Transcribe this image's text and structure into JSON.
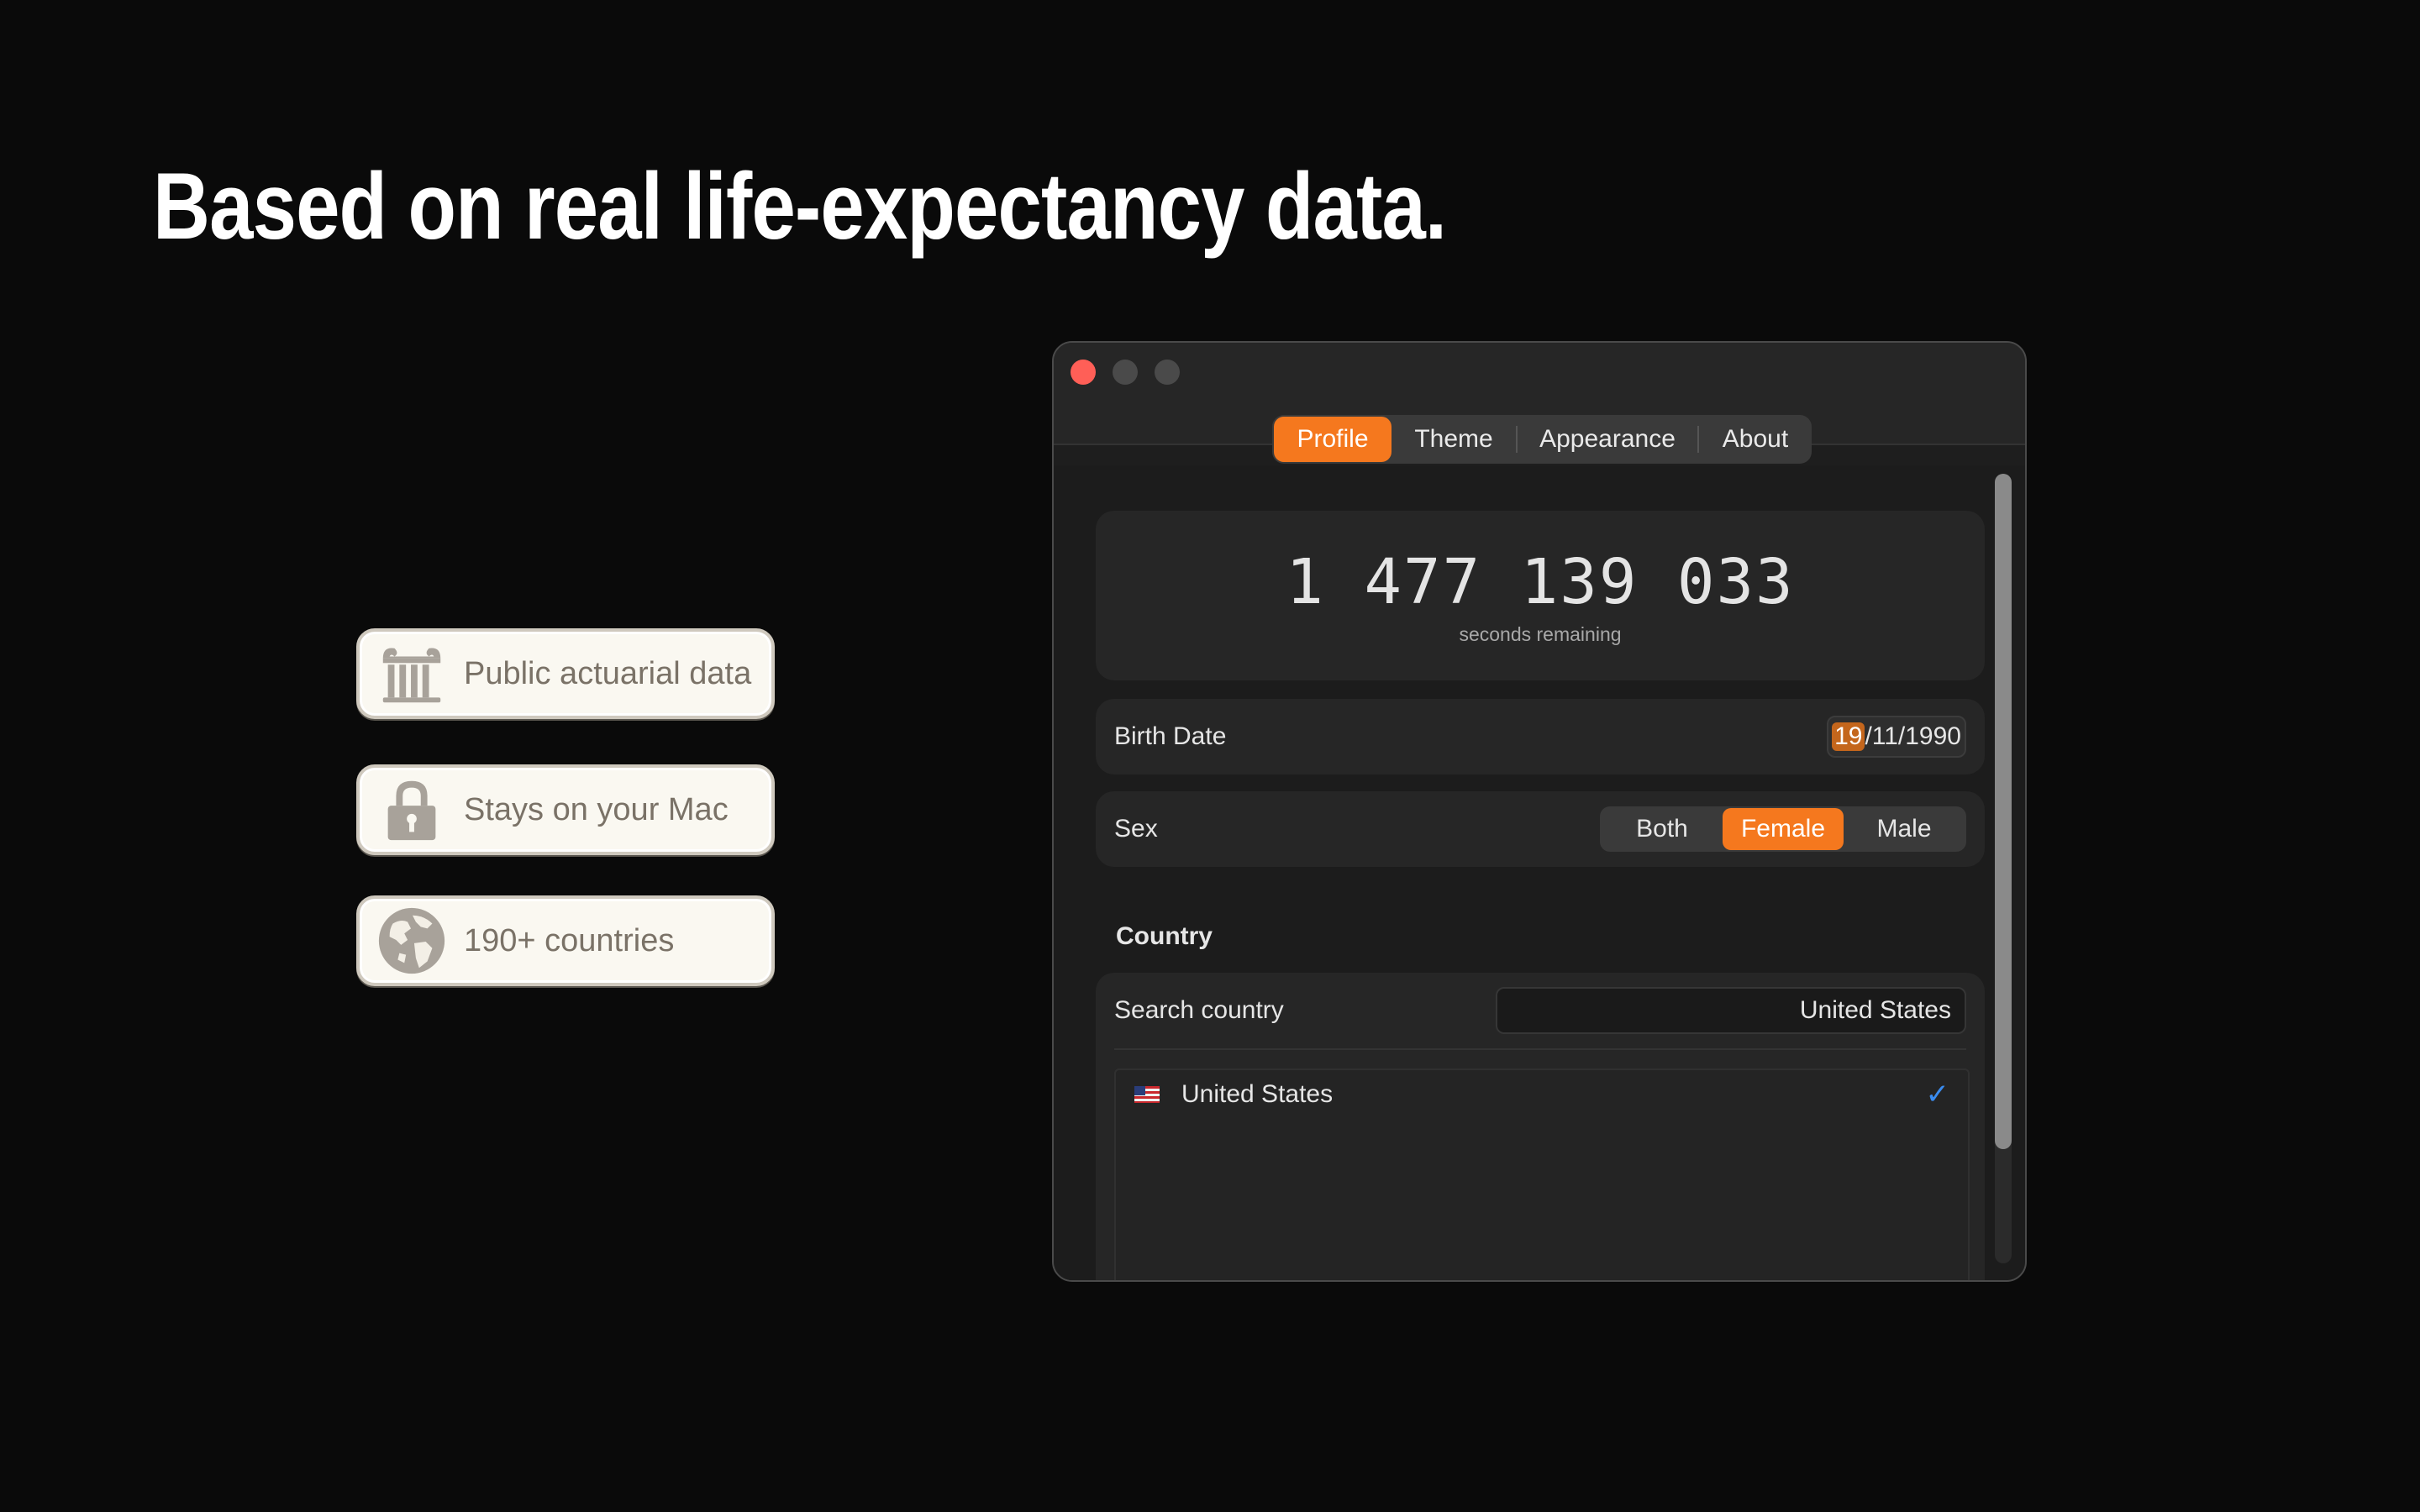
{
  "headline": "Based on real life-expectancy data.",
  "badges": [
    {
      "icon": "column-icon",
      "label": "Public actuarial data"
    },
    {
      "icon": "lock-icon",
      "label": "Stays on your Mac"
    },
    {
      "icon": "globe-icon",
      "label": "190+ countries"
    }
  ],
  "window": {
    "tabs": [
      {
        "label": "Profile",
        "active": true
      },
      {
        "label": "Theme",
        "active": false
      },
      {
        "label": "Appearance",
        "active": false
      },
      {
        "label": "About",
        "active": false
      }
    ],
    "counter": {
      "value": "1 477 139 033",
      "caption": "seconds remaining"
    },
    "birth_date": {
      "label": "Birth Date",
      "day": "19",
      "rest": "/11/1990"
    },
    "sex": {
      "label": "Sex",
      "options": [
        "Both",
        "Female",
        "Male"
      ],
      "selected": "Female"
    },
    "country": {
      "header": "Country",
      "search_label": "Search country",
      "search_value": "United States",
      "items": [
        {
          "name": "United States",
          "flag": "us-flag-icon",
          "selected": true
        }
      ]
    },
    "colors": {
      "accent": "#f5781e",
      "check": "#3a8cf0",
      "close": "#ff5f57"
    }
  }
}
